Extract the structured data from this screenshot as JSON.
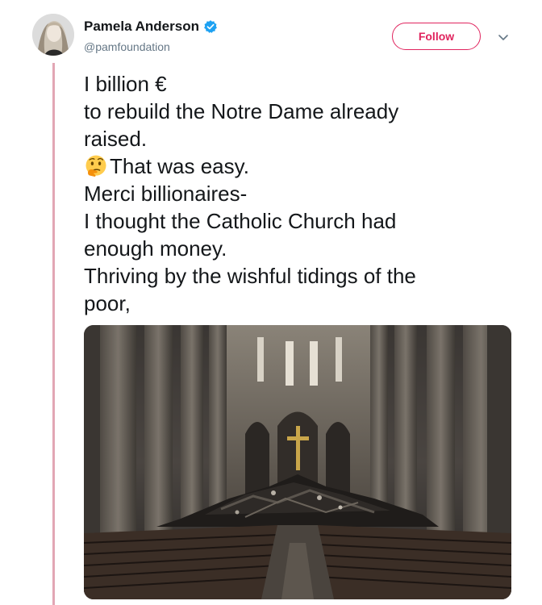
{
  "author": {
    "display_name": "Pamela Anderson",
    "handle": "@pamfoundation",
    "verified": true
  },
  "header": {
    "follow_label": "Follow",
    "menu_icon": "chevron-down-icon"
  },
  "tweet": {
    "lines": [
      "I billion €",
      "to rebuild the Notre Dame already",
      "raised.",
      "That was easy.",
      "Merci billionaires-",
      "I thought the Catholic Church had",
      "enough money.",
      "Thriving by the wishful tidings of the",
      "poor,"
    ],
    "emoji_icon": "thinking-face-icon"
  },
  "media": {
    "icon": "photo-notre-dame-interior"
  },
  "colors": {
    "accent": "#e0245e",
    "thread_line": "#e2a6b4",
    "verified": "#1da1f2",
    "handle": "#657786",
    "text": "#14171a"
  }
}
